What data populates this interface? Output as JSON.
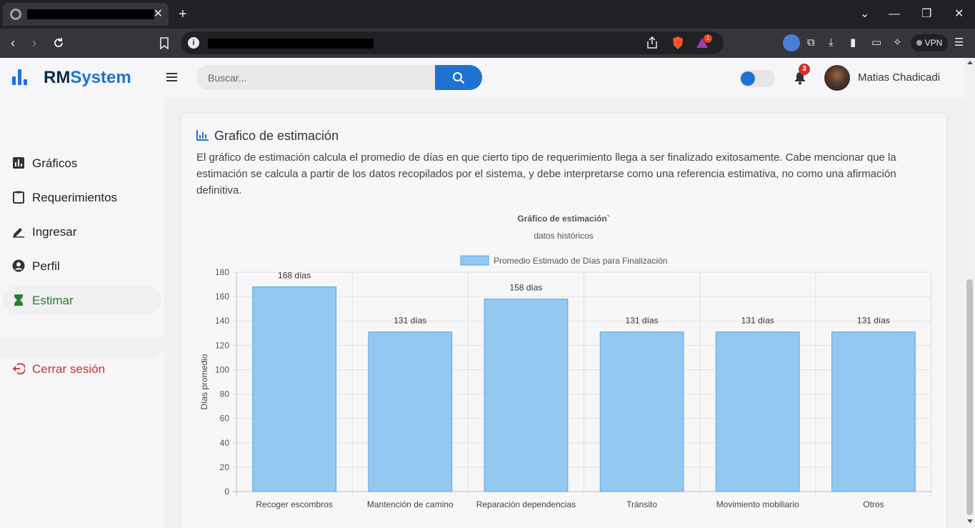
{
  "browser": {
    "vpn_label": "VPN",
    "notification_badge": "1"
  },
  "app": {
    "logo_part1": "RM",
    "logo_part2": "System",
    "search_placeholder": "Buscar...",
    "notification_count": "3",
    "user_name": "Matias Chadicadi"
  },
  "sidebar": {
    "items": [
      {
        "label": "Gráficos",
        "icon": "bar-chart-icon"
      },
      {
        "label": "Requerimientos",
        "icon": "clipboard-icon"
      },
      {
        "label": "Ingresar",
        "icon": "edit-icon"
      },
      {
        "label": "Perfil",
        "icon": "user-icon"
      },
      {
        "label": "Estimar",
        "icon": "hourglass-icon",
        "active": true
      }
    ],
    "logout_label": "Cerrar sesión"
  },
  "card": {
    "title": "Grafico de estimación",
    "description": "El gráfico de estimación calcula el promedio de días en que cierto tipo de requerimiento llega a ser finalizado exitosamente. Cabe mencionar que la estimación se calcula a partir de los datos recopilados por el sistema, y debe interpretarse como una referencia estimativa, no como una afirmación definitiva."
  },
  "colors": {
    "accent": "#1e73d2",
    "active_green": "#2e7d32",
    "logout_red": "#d32f2f",
    "bar_fill": "#93c9f0",
    "bar_stroke": "#5aa8e0"
  },
  "chart_data": {
    "type": "bar",
    "title": "Gráfico de estimación`",
    "subtitle": "datos históricos",
    "ylabel": "Días promedio",
    "xlabel": "",
    "legend": "top",
    "series": [
      {
        "name": "Promedio Estimado de Días para Finalización",
        "values": [
          168,
          131,
          158,
          131,
          131,
          131
        ]
      }
    ],
    "categories": [
      "Recoger escombros",
      "Mantención de camino",
      "Reparación dependencias",
      "Tránsito",
      "Movimiento mobiliario",
      "Otros"
    ],
    "data_labels": [
      "168 días",
      "131 días",
      "158 días",
      "131 días",
      "131 días",
      "131 días"
    ],
    "ylim": [
      0,
      180
    ],
    "yticks": [
      0,
      20,
      40,
      60,
      80,
      100,
      120,
      140,
      160,
      180
    ],
    "grid": true
  }
}
